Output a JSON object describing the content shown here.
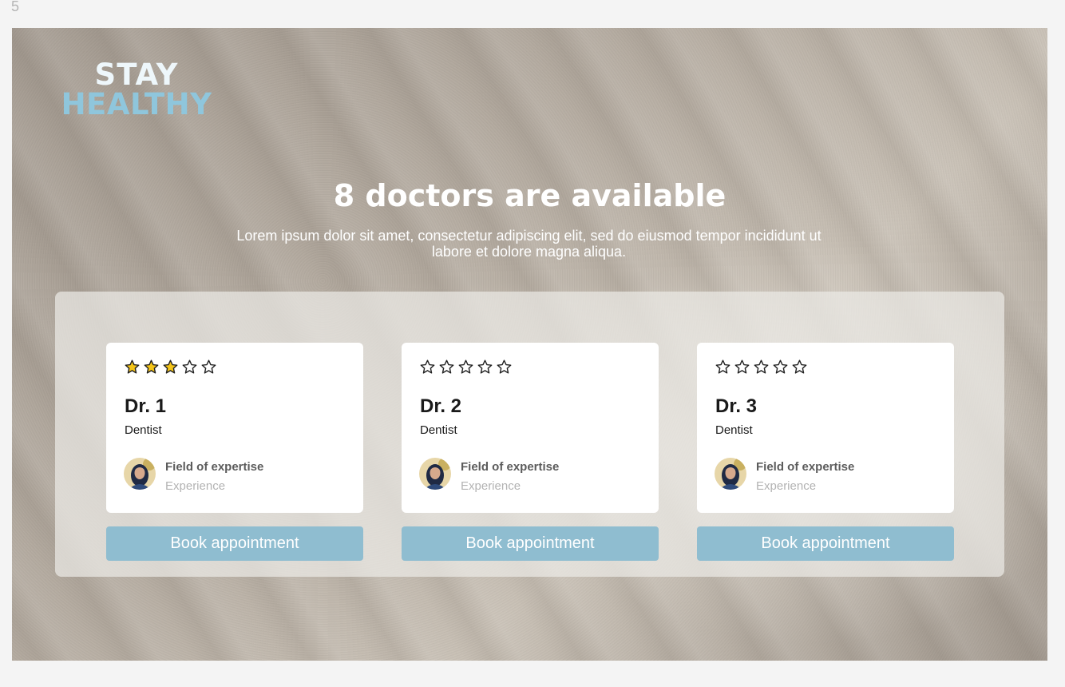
{
  "frame_number": "5",
  "logo": {
    "line1": "STAY",
    "line2": "HEALTHY"
  },
  "headline": "8 doctors are available",
  "subtitle": "Lorem ipsum dolor sit amet, consectetur adipiscing elit, sed do eiusmod tempor incididunt ut labore et dolore magna aliqua.",
  "doctors": [
    {
      "name": "Dr. 1",
      "specialty": "Dentist",
      "rating": 3,
      "max_rating": 5,
      "field_label": "Field of expertise",
      "experience_label": "Experience",
      "button_label": "Book appointment"
    },
    {
      "name": "Dr. 2",
      "specialty": "Dentist",
      "rating": 0,
      "max_rating": 5,
      "field_label": "Field of expertise",
      "experience_label": "Experience",
      "button_label": "Book appointment"
    },
    {
      "name": "Dr. 3",
      "specialty": "Dentist",
      "rating": 0,
      "max_rating": 5,
      "field_label": "Field of expertise",
      "experience_label": "Experience",
      "button_label": "Book appointment"
    }
  ],
  "icons": {
    "star": "star-icon",
    "avatar": "doctor-avatar"
  },
  "colors": {
    "accent": "#8fbdd0",
    "logo_top": "#eef7fb",
    "logo_bottom": "#8fc6dc",
    "star_filled": "#f5c518",
    "star_outline": "#222222"
  }
}
